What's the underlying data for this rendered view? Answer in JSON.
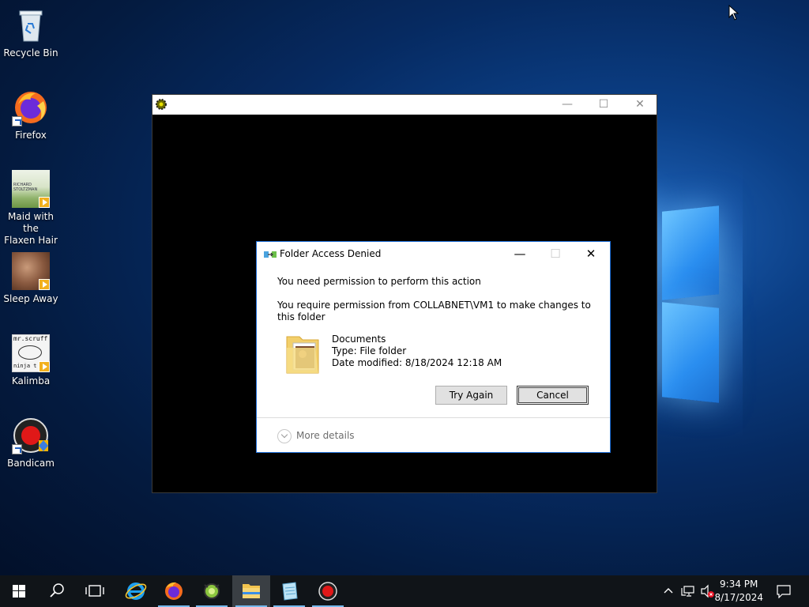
{
  "desktop": {
    "icons": [
      {
        "label": "Recycle Bin",
        "icon": "recycle-bin-icon"
      },
      {
        "label": "Firefox",
        "icon": "firefox-icon"
      },
      {
        "label": "Maid with the\nFlaxen Hair",
        "icon": "audio-file-icon",
        "thumb_text": "RICHARD STOLTZMAN"
      },
      {
        "label": "Sleep Away",
        "icon": "audio-file-icon"
      },
      {
        "label": "Kalimba",
        "icon": "audio-file-icon",
        "thumb_text_top": "mr.scruff",
        "thumb_text_bottom": "ninja t"
      },
      {
        "label": "Bandicam",
        "icon": "bandicam-icon"
      }
    ]
  },
  "app_window": {
    "icon": "gear-icon",
    "controls": [
      "minimize",
      "maximize",
      "close"
    ]
  },
  "dialog": {
    "title": "Folder Access Denied",
    "heading": "You need permission to perform this action",
    "message": "You require permission from COLLABNET\\VM1 to make changes to this folder",
    "file": {
      "name": "Documents",
      "type": "Type: File folder",
      "modified": "Date modified: 8/18/2024 12:18 AM"
    },
    "buttons": {
      "try_again": "Try Again",
      "cancel": "Cancel"
    },
    "more_details": "More details"
  },
  "taskbar": {
    "items": [
      "start",
      "search",
      "task-view",
      "internet-explorer",
      "firefox",
      "green-app",
      "file-explorer",
      "notepad-app",
      "bandicam"
    ],
    "active": "file-explorer",
    "tray": {
      "time": "9:34 PM",
      "date": "8/17/2024"
    }
  },
  "colors": {
    "accent": "#1e6fd9",
    "taskbar": "#101418",
    "desktop": "#062a61"
  }
}
